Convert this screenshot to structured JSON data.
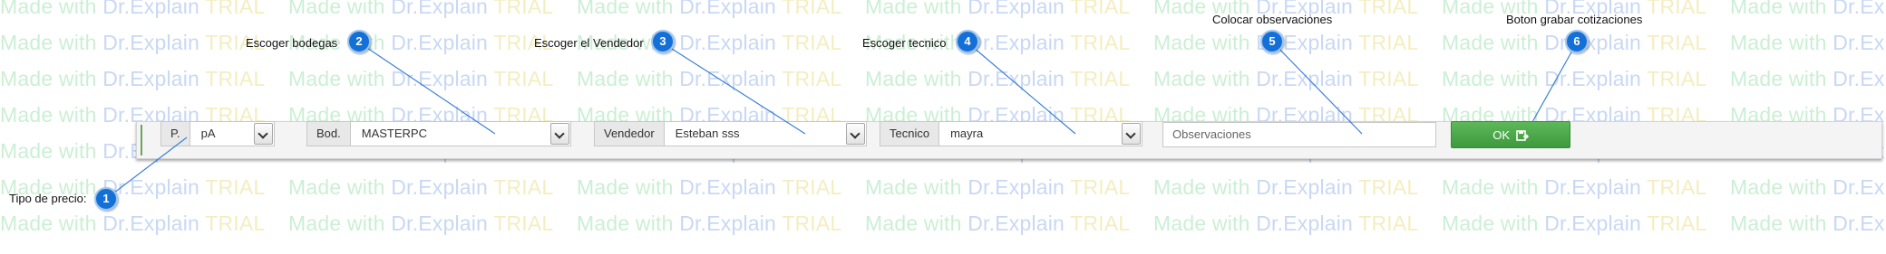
{
  "watermark": {
    "made_with": "Made with ",
    "dr_explain": "Dr.Explain",
    "trial": " TRIAL"
  },
  "toolbar": {
    "price_type": {
      "addon": "P.",
      "value": "pA"
    },
    "warehouse": {
      "addon": "Bod.",
      "value": "MASTERPC"
    },
    "seller": {
      "addon": "Vendedor",
      "value": "Esteban sss"
    },
    "technician": {
      "addon": "Tecnico",
      "value": "mayra"
    },
    "observations_placeholder": "Observaciones",
    "ok_label": "OK"
  },
  "callouts": [
    {
      "number": "1",
      "text": "Tipo de precio:"
    },
    {
      "number": "2",
      "text": "Escoger bodegas"
    },
    {
      "number": "3",
      "text": "Escoger el Vendedor"
    },
    {
      "number": "4",
      "text": "Escoger tecnico"
    },
    {
      "number": "5",
      "text": "Colocar observaciones"
    },
    {
      "number": "6",
      "text": "Boton grabar cotizaciones"
    }
  ],
  "colors": {
    "badge": "#1470d6",
    "ok_button": "#4aa847",
    "toolbar_bg": "#f4f4f4"
  },
  "icons": [
    "dropdown-arrow-icon",
    "save-icon"
  ]
}
